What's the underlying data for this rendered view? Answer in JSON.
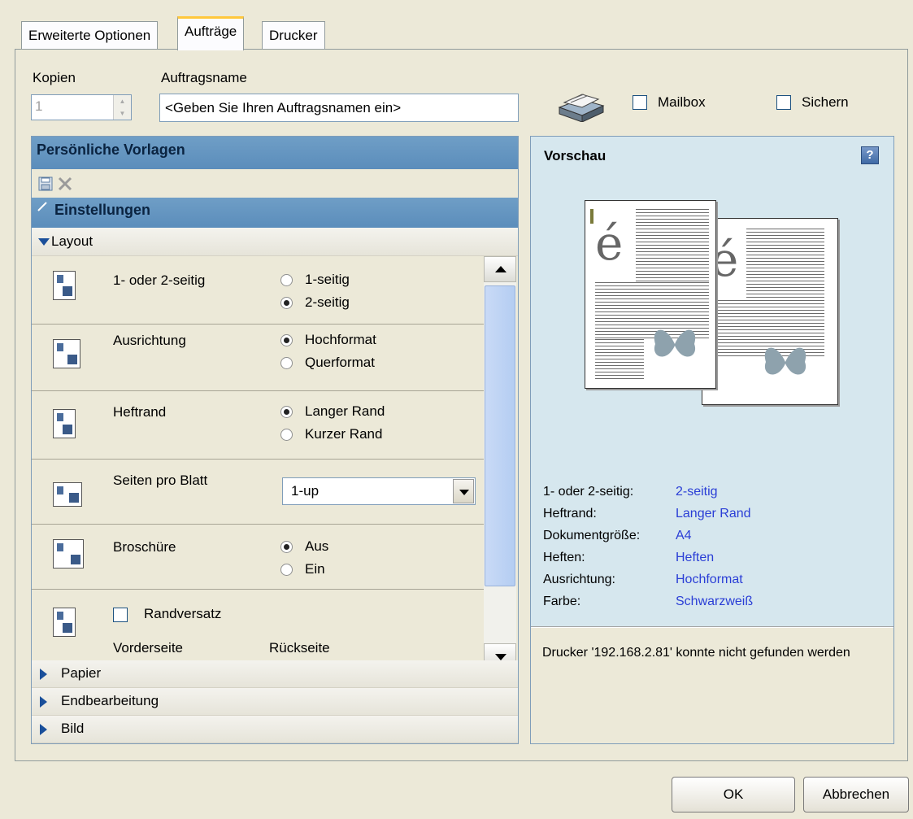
{
  "tabs": [
    "Erweiterte Optionen",
    "Aufträge",
    "Drucker"
  ],
  "copies": {
    "label": "Kopien",
    "value": "1"
  },
  "job_name": {
    "label": "Auftragsname",
    "value": "<Geben Sie Ihren Auftragsnamen ein>"
  },
  "mailbox_label": "Mailbox",
  "sichern_label": "Sichern",
  "templates_title": "Persönliche Vorlagen",
  "settings_title": "Einstellungen",
  "layout_label": "Layout",
  "rows": {
    "duplex": {
      "label": "1- oder 2-seitig",
      "opt1": "1-seitig",
      "opt2": "2-seitig"
    },
    "orientation": {
      "label": "Ausrichtung",
      "opt1": "Hochformat",
      "opt2": "Querformat"
    },
    "binding": {
      "label": "Heftrand",
      "opt1": "Langer Rand",
      "opt2": "Kurzer Rand"
    },
    "pages_per_sheet": {
      "label": "Seiten pro Blatt",
      "value": "1-up"
    },
    "booklet": {
      "label": "Broschüre",
      "opt1": "Aus",
      "opt2": "Ein"
    },
    "margin_shift": {
      "label": "Randversatz",
      "front": "Vorderseite",
      "back": "Rückseite"
    }
  },
  "sections": [
    "Papier",
    "Endbearbeitung",
    "Bild"
  ],
  "preview": {
    "title": "Vorschau",
    "help": "?",
    "glyph": "é",
    "summary": [
      {
        "key": "1- oder 2-seitig:",
        "value": "2-seitig"
      },
      {
        "key": "Heftrand:",
        "value": "Langer Rand"
      },
      {
        "key": "Dokumentgröße:",
        "value": "A4"
      },
      {
        "key": "Heften:",
        "value": "Heften"
      },
      {
        "key": "Ausrichtung:",
        "value": "Hochformat"
      },
      {
        "key": "Farbe:",
        "value": "Schwarzweiß"
      }
    ],
    "status": "Drucker '192.168.2.81' konnte nicht gefunden werden"
  },
  "buttons": {
    "ok": "OK",
    "cancel": "Abbrechen"
  }
}
